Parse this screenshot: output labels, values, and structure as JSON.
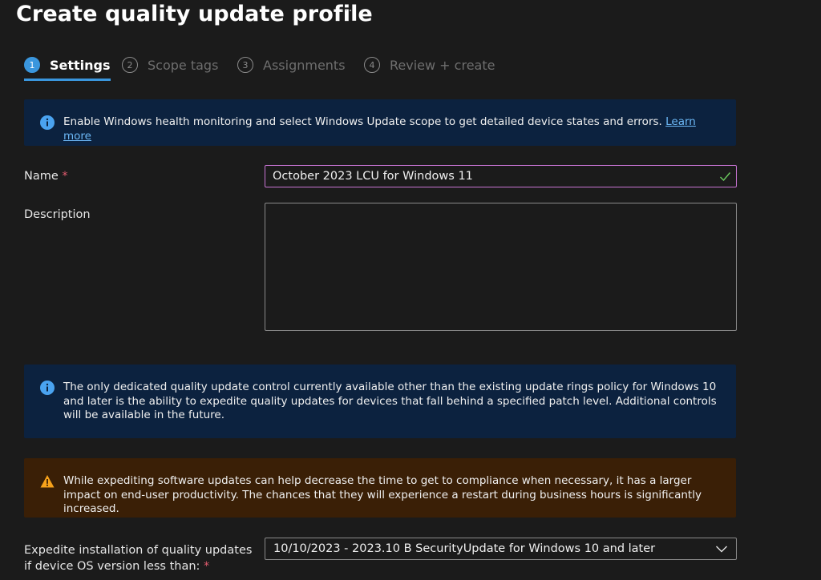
{
  "page": {
    "title": "Create quality update profile",
    "more": "···"
  },
  "tabs": [
    {
      "num": "1",
      "label": "Settings",
      "active": true
    },
    {
      "num": "2",
      "label": "Scope tags",
      "active": false
    },
    {
      "num": "3",
      "label": "Assignments",
      "active": false
    },
    {
      "num": "4",
      "label": "Review + create",
      "active": false
    }
  ],
  "banners": {
    "health": {
      "text": "Enable Windows health monitoring and select Windows Update scope to get detailed device states and errors.",
      "link": "Learn more"
    },
    "controls": {
      "text": "The only dedicated quality update control currently available other than the existing update rings policy for Windows 10 and later is the ability to expedite quality updates for devices that fall behind a specified patch level. Additional controls will be available in the future."
    },
    "warning": {
      "text": "While expediting software updates can help decrease the time to get to compliance when necessary, it has a larger impact on end-user productivity. The chances that they will experience a restart during business hours is significantly increased."
    }
  },
  "form": {
    "name_label": "Name",
    "required_mark": "*",
    "name_value": "October 2023 LCU for Windows 11",
    "description_label": "Description",
    "description_value": "",
    "expedite_label": "Expedite installation of quality updates if device OS version less than:",
    "expedite_value": "10/10/2023 - 2023.10 B SecurityUpdate for Windows 10 and later"
  },
  "colors": {
    "accent": "#3a96dd",
    "info_bg": "#0c223f",
    "warning_bg": "#3a1f06",
    "required": "#e05b6e",
    "focus_border": "#c874d3",
    "valid_check": "#6ccb5f"
  },
  "icons": {
    "info": "info-icon",
    "warning": "warning-icon",
    "valid": "checkmark-icon",
    "dropdown": "chevron-down-icon"
  }
}
